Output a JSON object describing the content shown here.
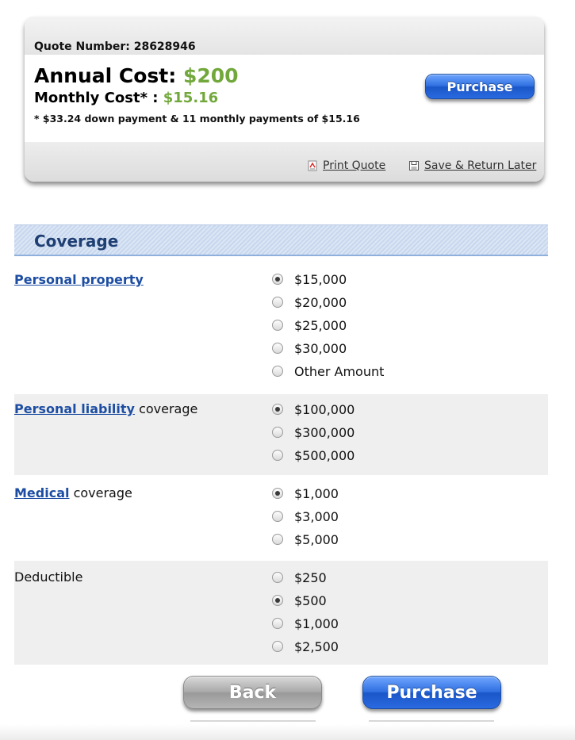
{
  "quote": {
    "number_label": "Quote Number: 28628946",
    "annual_label": "Annual Cost:",
    "annual_value": "$200",
    "monthly_label": "Monthly Cost* :",
    "monthly_value": "$15.16",
    "down_note": "* $33.24 down payment & 11 monthly payments of $15.16",
    "purchase_label": "Purchase",
    "print_label": "Print Quote",
    "save_label": "Save & Return Later"
  },
  "coverage": {
    "title": "Coverage",
    "personal_property": {
      "link": "Personal property",
      "options": [
        "$15,000",
        "$20,000",
        "$25,000",
        "$30,000",
        "Other Amount"
      ],
      "selected": "$15,000"
    },
    "personal_liability": {
      "link": "Personal liability",
      "suffix": " coverage",
      "options": [
        "$100,000",
        "$300,000",
        "$500,000"
      ],
      "selected": "$100,000"
    },
    "medical": {
      "link": "Medical",
      "suffix": " coverage",
      "options": [
        "$1,000",
        "$3,000",
        "$5,000"
      ],
      "selected": "$1,000"
    },
    "deductible": {
      "label": "Deductible",
      "options": [
        "$250",
        "$500",
        "$1,000",
        "$2,500"
      ],
      "selected": "$500"
    }
  },
  "actions": {
    "back_label": "Back",
    "purchase_label": "Purchase"
  },
  "colors": {
    "price_green": "#72a83b",
    "link_blue": "#1d4ea3",
    "header_title": "#1f3f73",
    "button_blue": "#2f6fe0"
  }
}
